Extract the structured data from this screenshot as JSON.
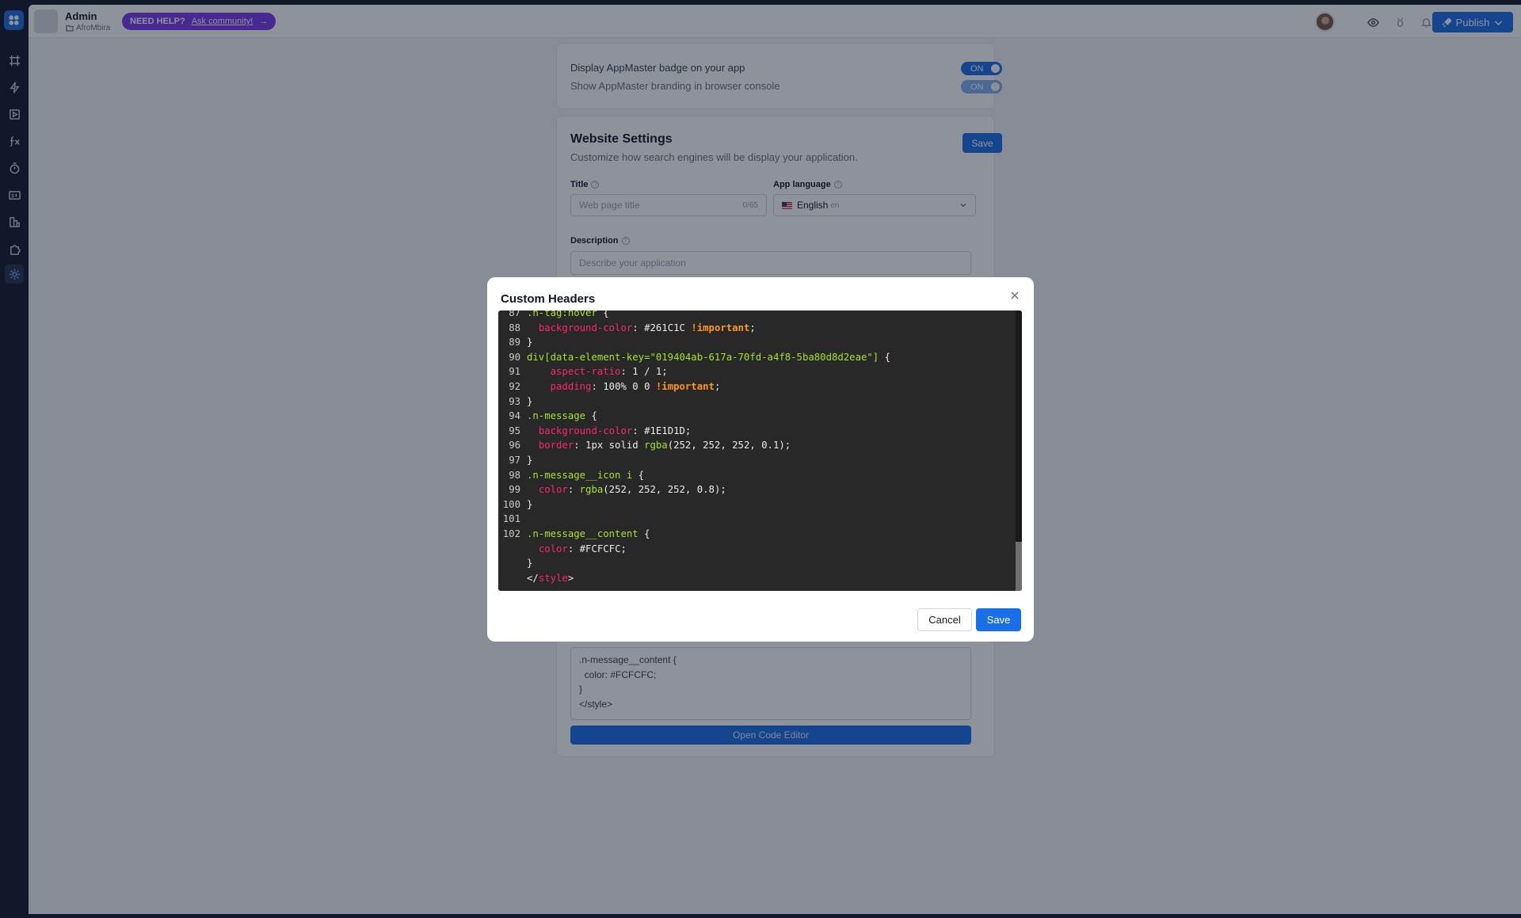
{
  "topbar": {
    "app_name": "Admin",
    "project_name": "AfroMbira",
    "help_label": "NEED HELP?",
    "help_link": "Ask community!",
    "help_arrow": "→",
    "publish_label": "Publish"
  },
  "branding": {
    "badge_label": "Display AppMaster badge on your app",
    "badge_toggle": "ON",
    "console_label": "Show AppMaster branding in browser console",
    "console_toggle": "ON"
  },
  "website_settings": {
    "title": "Website Settings",
    "subtitle": "Customize how search engines will be display your application.",
    "save_label": "Save",
    "title_label": "Title",
    "title_placeholder": "Web page title",
    "title_counter": "0/65",
    "language_label": "App language",
    "language_name": "English",
    "language_code": "en",
    "description_label": "Description",
    "description_placeholder": "Describe your application",
    "code_preview": [
      ".n-message__content {",
      "  color: #FCFCFC;",
      "}",
      "</style>"
    ],
    "open_editor_label": "Open Code Editor"
  },
  "modal": {
    "title": "Custom Headers",
    "cancel_label": "Cancel",
    "save_label": "Save",
    "code_lines": [
      {
        "n": "87",
        "parts": [
          {
            "t": ".n-tag:hover",
            "c": "sel"
          },
          {
            "t": " {",
            "c": ""
          }
        ]
      },
      {
        "n": "88",
        "parts": [
          {
            "t": "  ",
            "c": ""
          },
          {
            "t": "background-color",
            "c": "prop"
          },
          {
            "t": ": #261C1C ",
            "c": ""
          },
          {
            "t": "!important",
            "c": "imp"
          },
          {
            "t": ";",
            "c": ""
          }
        ]
      },
      {
        "n": "89",
        "parts": [
          {
            "t": "}",
            "c": ""
          }
        ]
      },
      {
        "n": "90",
        "parts": [
          {
            "t": "div[data-element-key=\"019404ab-617a-70fd-a4f8-5ba80d8d2eae\"]",
            "c": "sel"
          },
          {
            "t": " {",
            "c": ""
          }
        ]
      },
      {
        "n": "91",
        "parts": [
          {
            "t": "    ",
            "c": ""
          },
          {
            "t": "aspect-ratio",
            "c": "prop"
          },
          {
            "t": ": 1 / 1;",
            "c": ""
          }
        ]
      },
      {
        "n": "92",
        "parts": [
          {
            "t": "    ",
            "c": ""
          },
          {
            "t": "padding",
            "c": "prop"
          },
          {
            "t": ": 100% 0 0 ",
            "c": ""
          },
          {
            "t": "!important",
            "c": "imp"
          },
          {
            "t": ";",
            "c": ""
          }
        ]
      },
      {
        "n": "93",
        "parts": [
          {
            "t": "}",
            "c": ""
          }
        ]
      },
      {
        "n": "94",
        "parts": [
          {
            "t": ".n-message",
            "c": "sel"
          },
          {
            "t": " {",
            "c": ""
          }
        ]
      },
      {
        "n": "95",
        "parts": [
          {
            "t": "  ",
            "c": ""
          },
          {
            "t": "background-color",
            "c": "prop"
          },
          {
            "t": ": #1E1D1D;",
            "c": ""
          }
        ]
      },
      {
        "n": "96",
        "parts": [
          {
            "t": "  ",
            "c": ""
          },
          {
            "t": "border",
            "c": "prop"
          },
          {
            "t": ": 1px solid ",
            "c": ""
          },
          {
            "t": "rgba",
            "c": "sel"
          },
          {
            "t": "(252, 252, 252, 0.1);",
            "c": ""
          }
        ]
      },
      {
        "n": "97",
        "parts": [
          {
            "t": "}",
            "c": ""
          }
        ]
      },
      {
        "n": "98",
        "parts": [
          {
            "t": ".n-message__icon i",
            "c": "sel"
          },
          {
            "t": " {",
            "c": ""
          }
        ]
      },
      {
        "n": "99",
        "parts": [
          {
            "t": "  ",
            "c": ""
          },
          {
            "t": "color",
            "c": "prop"
          },
          {
            "t": ": ",
            "c": ""
          },
          {
            "t": "rgba",
            "c": "sel"
          },
          {
            "t": "(252, 252, 252, 0.8);",
            "c": ""
          }
        ]
      },
      {
        "n": "100",
        "parts": [
          {
            "t": "}",
            "c": ""
          }
        ]
      },
      {
        "n": "101",
        "parts": []
      },
      {
        "n": "102",
        "parts": [
          {
            "t": ".n-message__content",
            "c": "sel"
          },
          {
            "t": " {",
            "c": ""
          }
        ]
      },
      {
        "n": "",
        "parts": [
          {
            "t": "  ",
            "c": ""
          },
          {
            "t": "color",
            "c": "prop"
          },
          {
            "t": ": #FCFCFC;",
            "c": ""
          }
        ]
      },
      {
        "n": "",
        "parts": [
          {
            "t": "}",
            "c": ""
          }
        ]
      },
      {
        "n": "",
        "parts": [
          {
            "t": "</",
            "c": ""
          },
          {
            "t": "style",
            "c": "tag"
          },
          {
            "t": ">",
            "c": ""
          }
        ]
      }
    ]
  },
  "colors": {
    "accent": "#1a6fe6",
    "help_pill": "#7c3aed",
    "rail": "#121a2b",
    "editor_bg": "#282828"
  },
  "icons": {
    "rail": [
      "canvas-icon",
      "lightning-icon",
      "play-box-icon",
      "function-icon",
      "timer-icon",
      "id-card-icon",
      "layers-icon",
      "puzzle-icon",
      "gear-icon"
    ],
    "topbar": [
      "eye-icon",
      "bug-icon",
      "bell-icon",
      "rocket-icon",
      "chevron-down-icon"
    ]
  }
}
